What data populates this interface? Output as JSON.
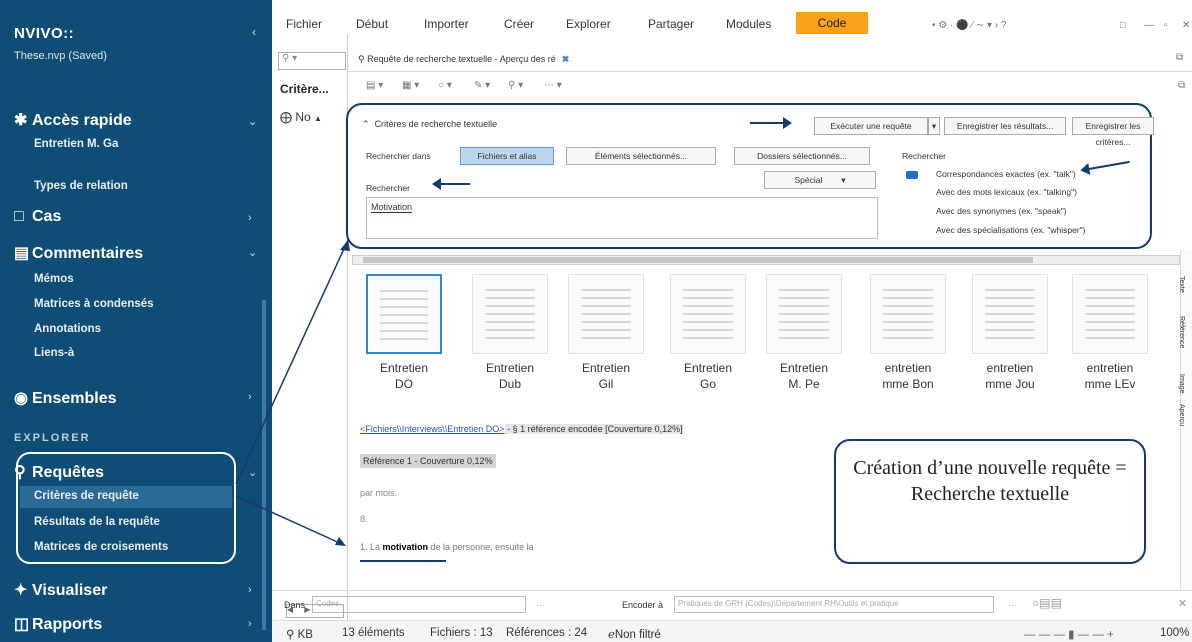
{
  "sidebar": {
    "app_name": "NVIVO::",
    "file": "These.nvp (Saved)",
    "quick_access": "Accès rapide",
    "quick_item": "Entretien M. Ga",
    "relation_types": "Types de relation",
    "cases": "Cas",
    "comments": "Commentaires",
    "comment_items": [
      "Mémos",
      "Matrices à condensés",
      "Annotations",
      "Liens-à"
    ],
    "sets": "Ensembles",
    "explorer_heading": "EXPLORER",
    "queries": "Requêtes",
    "query_items": [
      "Critères de requête",
      "Résultats de la requête",
      "Matrices de croisements"
    ],
    "visualize": "Visualiser",
    "reports": "Rapports"
  },
  "menubar": {
    "items": [
      "Fichier",
      "Début",
      "Importer",
      "Créer",
      "Explorer",
      "Partager",
      "Modules"
    ],
    "active": "Code"
  },
  "left_pane": {
    "title": "Critère...",
    "row": "No"
  },
  "tab": {
    "label": "Requête de recherche textuelle - Aperçu des ré"
  },
  "criteria": {
    "title": "Critères de recherche textuelle",
    "run_query": "Exécuter une requête",
    "save_results": "Enregistrer les résultats...",
    "save_criteria": "Enregistrer les critères...",
    "search_in_label": "Rechercher dans",
    "scope_files": "Fichiers et alias",
    "scope_selected": "Éléments sélectionnés...",
    "scope_folders": "Dossiers sélectionnés...",
    "search_label": "Rechercher",
    "special": "Spécial",
    "search_text": "Motivation",
    "right_label": "Rechercher",
    "options": [
      "Correspondances exactes (ex. \"talk\")",
      "Avec des mots lexicaux (ex. \"talking\")",
      "Avec des synonymes (ex. \"speak\")",
      "Avec des spécialisations (ex. \"whisper\")"
    ]
  },
  "thumbnails": [
    {
      "l1": "Entretien",
      "l2": "DO",
      "selected": true
    },
    {
      "l1": "Entretien",
      "l2": "Dub",
      "selected": false
    },
    {
      "l1": "Entretien",
      "l2": "Gil",
      "selected": false
    },
    {
      "l1": "Entretien",
      "l2": "Go",
      "selected": false
    },
    {
      "l1": "Entretien",
      "l2": "M. Pe",
      "selected": false
    },
    {
      "l1": "entretien",
      "l2": "mme Bon",
      "selected": false
    },
    {
      "l1": "entretien",
      "l2": "mme Jou",
      "selected": false
    },
    {
      "l1": "entretien",
      "l2": "mme LEv",
      "selected": false
    }
  ],
  "side_tabs": [
    "Texte",
    "Référence",
    "Image",
    "Aperçu"
  ],
  "preview": {
    "file_link": "<Fichiers\\\\Interviews\\\\Entretien DO>",
    "file_meta": " - § 1 référence encodée  [Couverture 0,12%]",
    "reference": "Référence 1 - Couverture 0,12%",
    "line1": "par mois.",
    "line2": "8.",
    "line3_pre": "1. La ",
    "line3_word": "motivation",
    "line3_post": " de la personne, ensuite la"
  },
  "note": {
    "text": "Création d’une nouvelle requête = Recherche textuelle"
  },
  "encode_bar": {
    "in_label": "Dans",
    "in_value": "Codes",
    "encode_label": "Encoder à",
    "encode_value": "Pratiques de GRH (Codes)\\Département RH\\Outils et pratique"
  },
  "status": {
    "user": "KB",
    "items": "13 éléments",
    "files": "Fichiers : 13",
    "refs": "Références : 24",
    "filter": "Non filtré",
    "zoom": "100%"
  }
}
